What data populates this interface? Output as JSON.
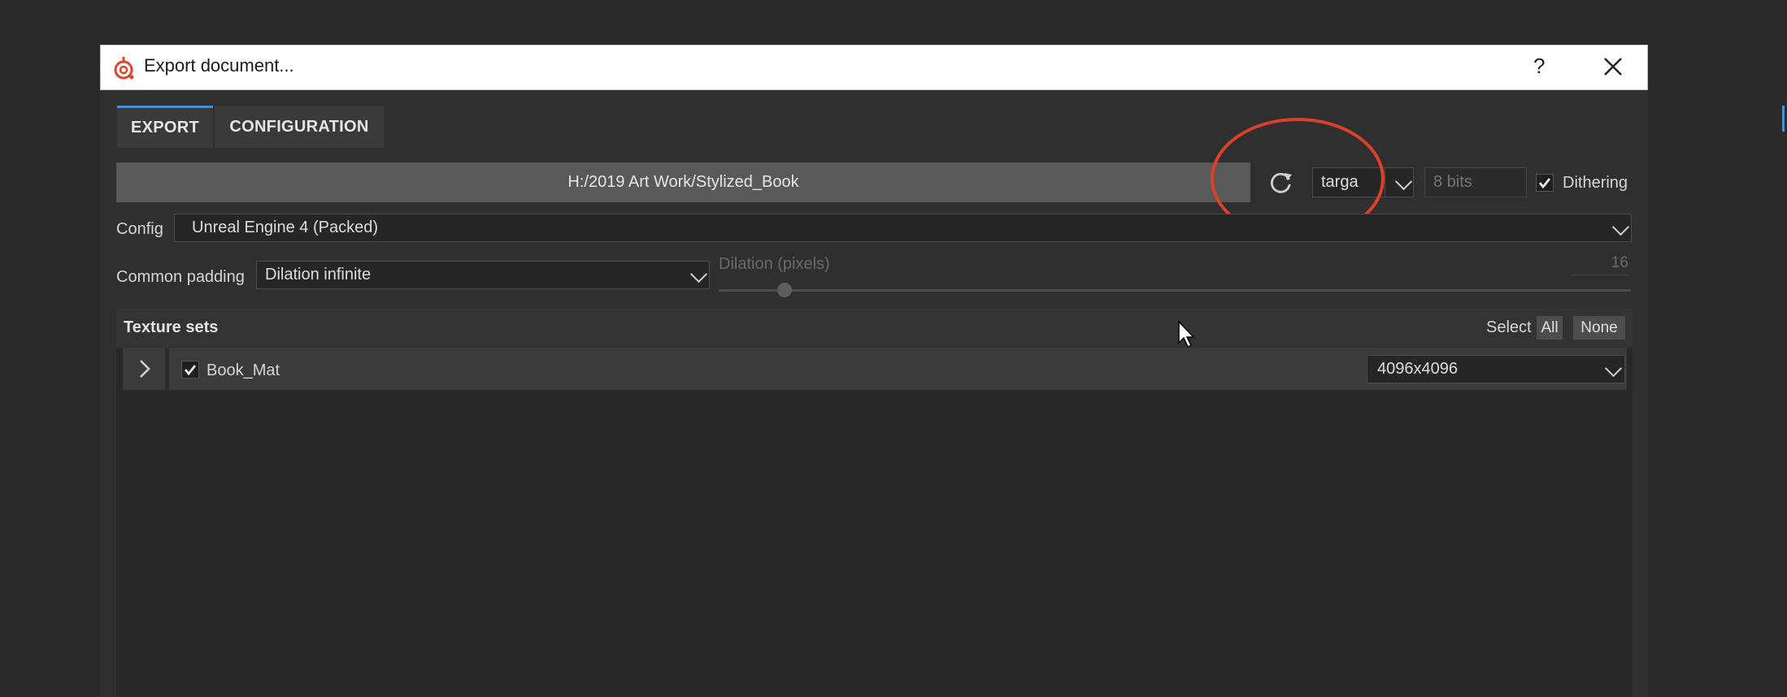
{
  "window": {
    "title": "Export document...",
    "help_label": "?",
    "close_label": "✕"
  },
  "tabs": [
    {
      "label": "EXPORT",
      "active": true
    },
    {
      "label": "CONFIGURATION",
      "active": false
    }
  ],
  "export_path": "H:/2019 Art Work/Stylized_Book",
  "format": {
    "value": "targa",
    "bit_depth_placeholder": "8 bits",
    "dithering_label": "Dithering",
    "dithering_checked": true
  },
  "config": {
    "label": "Config",
    "value": "Unreal Engine 4 (Packed)"
  },
  "padding": {
    "label": "Common padding",
    "value": "Dilation infinite",
    "dilation_label": "Dilation (pixels)",
    "dilation_value": "16",
    "dilation_fraction": 0.072
  },
  "texture_sets": {
    "title": "Texture sets",
    "select_label": "Select",
    "all_label": "All",
    "none_label": "None",
    "items": [
      {
        "name": "Book_Mat",
        "checked": true,
        "resolution": "4096x4096"
      }
    ]
  },
  "colors": {
    "accent": "#4a8fd4",
    "annotation_circle": "#d9412a",
    "logo": "#e0452b"
  }
}
